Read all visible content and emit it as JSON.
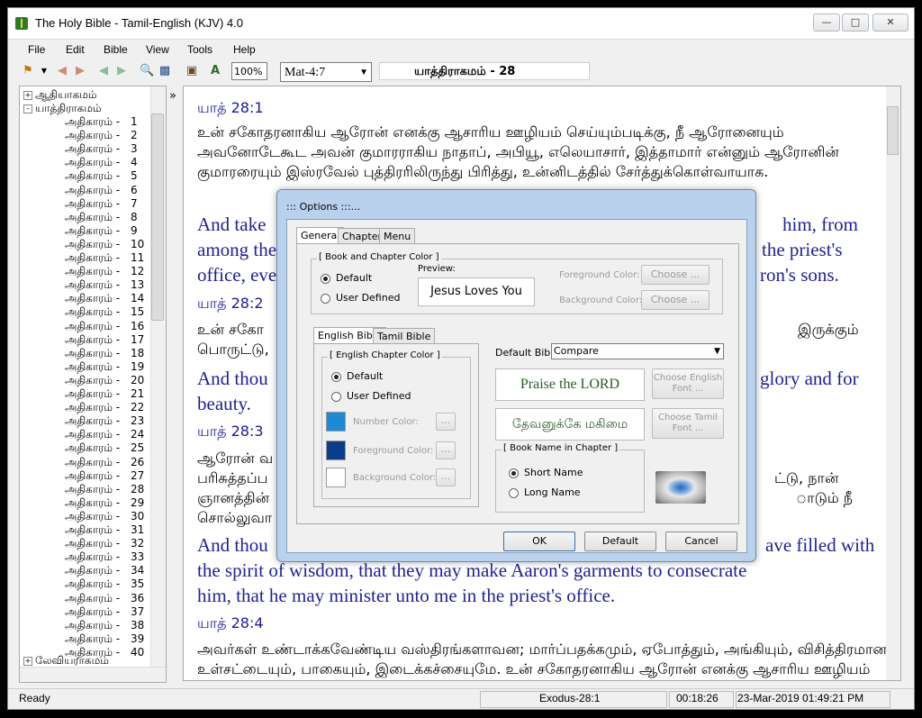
{
  "window": {
    "title": "The Holy Bible - Tamil-English (KJV) 4.0"
  },
  "menu": [
    "File",
    "Edit",
    "Bible",
    "View",
    "Tools",
    "Help"
  ],
  "toolbar": {
    "zoom": "100%",
    "reference": "Mat-4:7",
    "book_display": "யாத்திராகமம்  -  28"
  },
  "tree": {
    "book1": "ஆதியாகமம்",
    "book2": "யாத்திராகமம்",
    "book3": "லேவியராகமம்",
    "chapter_label": "அதிகாரம்",
    "chapters": [
      "1",
      "2",
      "3",
      "4",
      "5",
      "6",
      "7",
      "8",
      "9",
      "10",
      "11",
      "12",
      "13",
      "14",
      "15",
      "16",
      "17",
      "18",
      "19",
      "20",
      "21",
      "22",
      "23",
      "24",
      "25",
      "26",
      "27",
      "28",
      "29",
      "30",
      "31",
      "32",
      "33",
      "34",
      "35",
      "36",
      "37",
      "38",
      "39",
      "40"
    ]
  },
  "content": {
    "ref1": "யாத்  28:1",
    "tamil1": "உன் சகோதரனாகிய ஆரோன் எனக்கு ஆசாரிய ஊழியம் செய்யும்படிக்கு, நீ ஆரோனையும் அவனோடேகூட அவன் குமாரராகிய நாதாப், அபியூ, எலெயாசார், இத்தாமார் என்னும் ஆரோனின் குமாரரையும் இஸ்ரவேல் புத்திரரிலிருந்து பிரித்து, உன்னிடத்தில் சேர்த்துக்கொள்வாயாக.",
    "eng1a": "And take",
    "eng1b": "him, from",
    "eng1c": "among the",
    "eng1d": "the priest's",
    "eng1e": "office, eve",
    "eng1f": "ron's sons.",
    "ref2": "யாத்  28:2",
    "tamil2a": "உன் சகோ",
    "tamil2b": "இருக்கும்",
    "tamil2c": "பொருட்டு,",
    "eng2a": "And thou",
    "eng2b": "glory and for",
    "eng2c": "beauty.",
    "ref3": "யாத்  28:3",
    "tamil3a": "ஆரோன் வ",
    "tamil3b": "பரிசுத்தப்ப",
    "tamil3c": "ட்டு, நான்",
    "tamil3d": "ஞானத்தின்",
    "tamil3e": "ாடும் நீ",
    "tamil3f": "சொல்லுவா",
    "eng3a": "And thou",
    "eng3b": "ave filled with",
    "eng3c": "the spirit of wisdom, that they may make Aaron's garments to consecrate",
    "eng3d": "him, that he may minister unto me in the priest's office.",
    "ref4": "யாத்  28:4",
    "tamil4": "அவர்கள் உண்டாக்கவேண்டிய வஸ்திரங்களாவன; மார்ப்பதக்கமும், ஏபோத்தும், அங்கியும், விசித்திரமான உள்சட்டையும், பாகையும், இடைக்கச்சையுமே. உன் சகோதரனாகிய ஆரோன் எனக்கு ஆசாரிய ஊழியம் செய்யும்படி அவனுக்கும்"
  },
  "status": {
    "ready": "Ready",
    "location": "Exodus-28:1",
    "elapsed": "00:18:26",
    "datetime": "23-Mar-2019 01:49:21 PM"
  },
  "dialog": {
    "title": "::: Options :::...",
    "tabs": [
      "General",
      "Chapter",
      "Menu"
    ],
    "book_chapter_group": "[ Book and Chapter Color ]",
    "default": "Default",
    "user_defined": "User Defined",
    "preview_label": "Preview:",
    "preview_text": "Jesus Loves You",
    "fg_color": "Foreground Color:",
    "bg_color": "Background Color:",
    "choose": "Choose ...",
    "subtabs": [
      "English Bible",
      "Tamil Bible"
    ],
    "english_chapter_group": "[ English Chapter Color ]",
    "number_color": "Number Color:",
    "ellipsis": "...",
    "default_bible_label": "Default Bible:",
    "default_bible_value": "Compare",
    "praise": "Praise the LORD",
    "tamil_praise": "தேவனுக்கே மகிமை",
    "choose_english_font": "Choose English Font ...",
    "choose_tamil_font": "Choose Tamil Font ...",
    "book_name_group": "[ Book Name in Chapter ]",
    "short_name": "Short Name",
    "long_name": "Long Name",
    "ok": "OK",
    "default_btn": "Default",
    "cancel": "Cancel",
    "colors": {
      "number": "#1e8ad6",
      "foreground": "#0a3d8a",
      "background": "#ffffff"
    }
  }
}
